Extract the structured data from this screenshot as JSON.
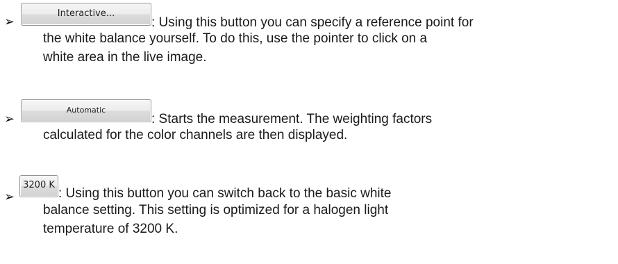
{
  "items": [
    {
      "button_label": "Interactive...",
      "lead": ": Using this button you can specify a reference point for",
      "lines": [
        "the white balance yourself. To do this, use the pointer to click on a",
        "white area in the live image."
      ]
    },
    {
      "button_label": "Automatic",
      "lead": ": Starts the measurement. The weighting factors",
      "lines": [
        "calculated for the color channels are then displayed."
      ]
    },
    {
      "button_label": "3200 K",
      "lead": ": Using this button you can switch back to the basic white",
      "lines": [
        "balance setting. This setting is optimized for a halogen light",
        "temperature of 3200 K."
      ]
    }
  ],
  "bullet_glyph": "➢"
}
